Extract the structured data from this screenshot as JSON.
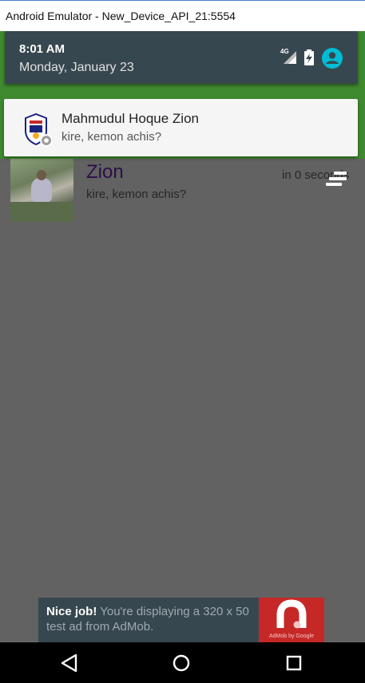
{
  "window": {
    "title": "Android Emulator - New_Device_API_21:5554"
  },
  "status_shade": {
    "time": "8:01 AM",
    "date": "Monday, January 23",
    "network_label": "4G",
    "icons": [
      "signal-icon",
      "battery-charging-icon",
      "profile-icon"
    ],
    "profile_color": "#00bcd4"
  },
  "notification": {
    "title": "Mahmudul Hoque Zion",
    "text": "kire, kemon achis?",
    "icon": "app-emblem-icon"
  },
  "chat_list": {
    "items": [
      {
        "name": "Zion",
        "time": "in 0 seconds",
        "message": "kire, kemon achis?"
      }
    ]
  },
  "ad_banner": {
    "headline": "Nice job!",
    "body": " You're displaying a 320 x 50 test ad from AdMob.",
    "brand": "AdMob by Google",
    "accent": "#c62828"
  },
  "navbar": {
    "buttons": [
      "back-icon",
      "home-icon",
      "recents-icon"
    ]
  }
}
